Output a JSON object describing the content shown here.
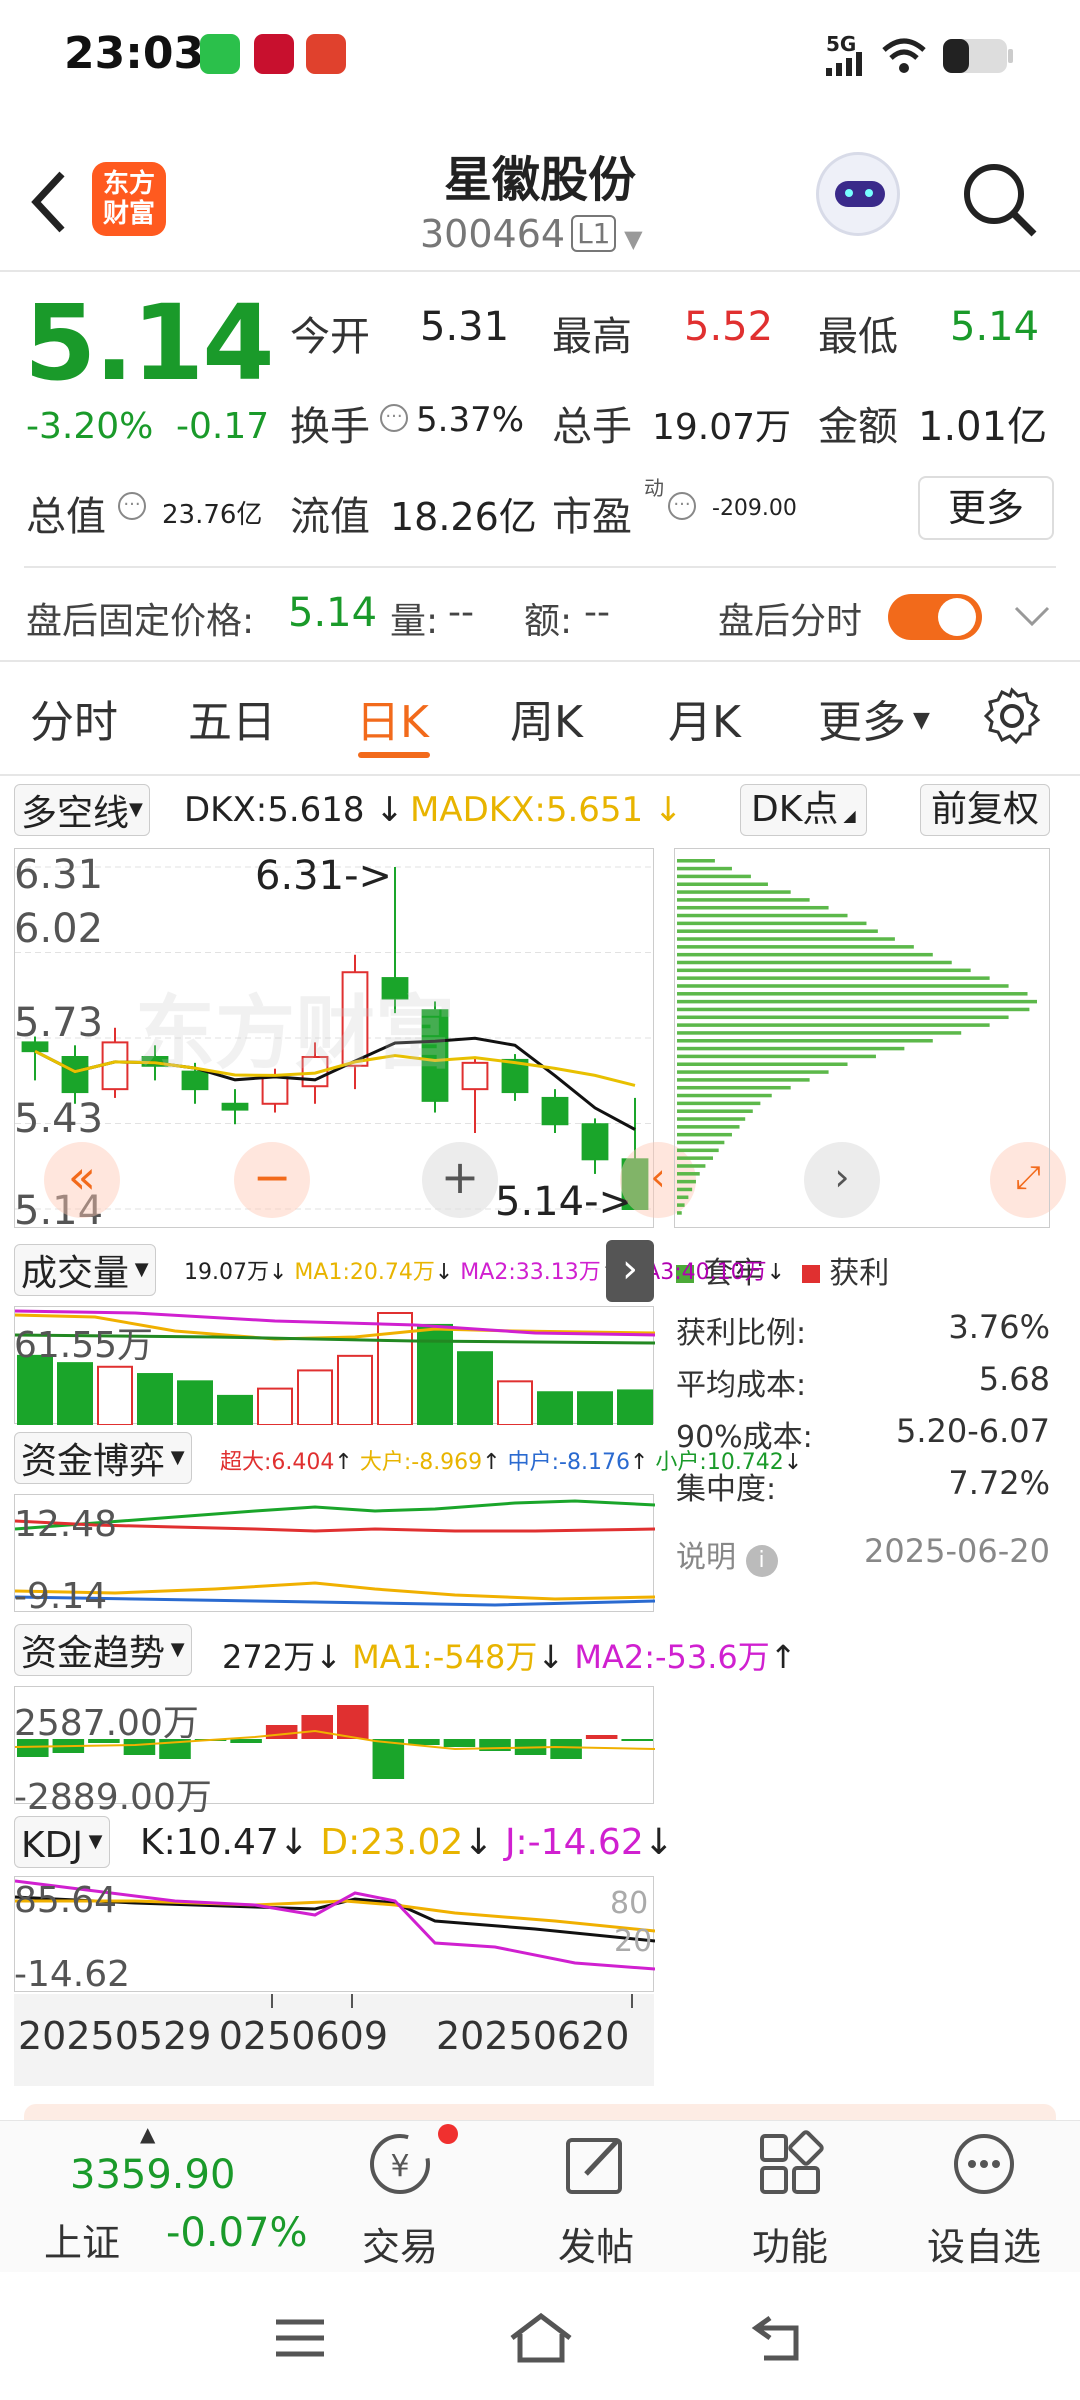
{
  "status": {
    "time": "23:03",
    "network": "5G"
  },
  "header": {
    "back_icon": "chevron-left-icon",
    "brand": [
      "东方",
      "财富"
    ],
    "title": "星徽股份",
    "code": "300464",
    "level": "L1"
  },
  "quote": {
    "price": "5.14",
    "change_pct": "-3.20%",
    "change": "-0.17",
    "open_label": "今开",
    "open": "5.31",
    "high_label": "最高",
    "high": "5.52",
    "low_label": "最低",
    "low": "5.14",
    "turnover_label": "换手",
    "turnover": "5.37%",
    "volume_label": "总手",
    "volume": "19.07万",
    "amount_label": "金额",
    "amount": "1.01亿",
    "mcap_label": "总值",
    "mcap": "23.76亿",
    "float_label": "流值",
    "float": "18.26亿",
    "pe_label": "市盈",
    "pe_sup": "动",
    "pe": "-209.00",
    "more": "更多"
  },
  "afterhours": {
    "label": "盘后固定价格:",
    "price": "5.14",
    "vol_label": "量:",
    "vol": "--",
    "amt_label": "额:",
    "amt": "--",
    "toggle_label": "盘后分时"
  },
  "tabs": [
    "分时",
    "五日",
    "日K",
    "周K",
    "月K",
    "更多"
  ],
  "chart": {
    "indicator": "多空线",
    "dkx": "DKX:5.618",
    "madkx": "MADKX:5.651",
    "dk_point": "DK点",
    "adjust": "前复权",
    "y_labels": [
      "6.31",
      "6.02",
      "5.73",
      "5.43",
      "5.14"
    ],
    "high_mark": "6.31->",
    "low_mark": "5.14->",
    "watermark": "东方财富"
  },
  "chart_data": {
    "type": "candlestick",
    "candles": [
      {
        "o": 5.71,
        "c": 5.68,
        "h": 5.73,
        "l": 5.58
      },
      {
        "o": 5.66,
        "c": 5.54,
        "h": 5.7,
        "l": 5.5
      },
      {
        "o": 5.55,
        "c": 5.71,
        "h": 5.76,
        "l": 5.52
      },
      {
        "o": 5.66,
        "c": 5.63,
        "h": 5.7,
        "l": 5.58
      },
      {
        "o": 5.61,
        "c": 5.55,
        "h": 5.64,
        "l": 5.5
      },
      {
        "o": 5.5,
        "c": 5.48,
        "h": 5.55,
        "l": 5.43
      },
      {
        "o": 5.5,
        "c": 5.59,
        "h": 5.62,
        "l": 5.47
      },
      {
        "o": 5.56,
        "c": 5.66,
        "h": 5.71,
        "l": 5.5
      },
      {
        "o": 5.63,
        "c": 5.95,
        "h": 6.01,
        "l": 5.55
      },
      {
        "o": 5.93,
        "c": 5.86,
        "h": 6.31,
        "l": 5.81
      },
      {
        "o": 5.82,
        "c": 5.51,
        "h": 5.85,
        "l": 5.47
      },
      {
        "o": 5.55,
        "c": 5.64,
        "h": 5.66,
        "l": 5.4
      },
      {
        "o": 5.65,
        "c": 5.54,
        "h": 5.67,
        "l": 5.51
      },
      {
        "o": 5.52,
        "c": 5.43,
        "h": 5.55,
        "l": 5.4
      },
      {
        "o": 5.43,
        "c": 5.31,
        "h": 5.45,
        "l": 5.26
      },
      {
        "o": 5.31,
        "c": 5.14,
        "h": 5.52,
        "l": 5.14
      }
    ],
    "ylim": [
      5.14,
      6.31
    ]
  },
  "volume": {
    "label": "成交量",
    "vol": "19.07万",
    "ma1": "MA1:20.74万",
    "ma2": "MA2:33.13万",
    "ma3": "MA3:40.10万",
    "axis": "61.55万",
    "bars": [
      38,
      34,
      32,
      28,
      24,
      16,
      20,
      30,
      38,
      61.55,
      55,
      40,
      24,
      18,
      18,
      19
    ]
  },
  "capital": {
    "label": "资金博弈",
    "super": "超大:6.404",
    "large": "大户:-8.969",
    "mid": "中户:-8.176",
    "small": "小户:10.742",
    "axis_top": "12.48",
    "axis_bottom": "-9.14"
  },
  "trend": {
    "label": "资金趋势",
    "val": "272万",
    "ma1": "MA1:-548万",
    "ma2": "MA2:-53.6万",
    "axis_top": "2587.00万",
    "axis_bottom": "-2889.00万"
  },
  "kdj": {
    "label": "KDJ",
    "k": "K:10.47",
    "d": "D:23.02",
    "j": "J:-14.62",
    "axis_top": "85.64",
    "axis_bottom": "-14.62",
    "r80": "80",
    "r20": "20"
  },
  "dates": [
    "20250529",
    "20250609",
    "20250620"
  ],
  "chip": {
    "legend_trap": "套牢",
    "legend_profit": "获利",
    "rows": [
      {
        "k": "获利比例:",
        "v": "3.76%"
      },
      {
        "k": "平均成本:",
        "v": "5.68"
      },
      {
        "k": "90%成本:",
        "v": "5.20-6.07"
      },
      {
        "k": "集中度:",
        "v": "7.72%"
      }
    ],
    "note": "说明",
    "date": "2025-06-20",
    "bars": [
      40,
      58,
      78,
      96,
      120,
      140,
      160,
      180,
      200,
      212,
      230,
      250,
      270,
      290,
      310,
      330,
      350,
      370,
      380,
      372,
      350,
      330,
      300,
      270,
      240,
      210,
      180,
      160,
      140,
      120,
      100,
      88,
      80,
      72,
      66,
      58,
      50,
      44,
      38,
      30,
      24,
      20,
      16,
      12,
      8,
      5
    ]
  },
  "index": {
    "value": "3359.90",
    "name": "上证",
    "change": "-0.07%"
  },
  "bottom_nav": [
    "交易",
    "发帖",
    "功能",
    "设自选"
  ]
}
